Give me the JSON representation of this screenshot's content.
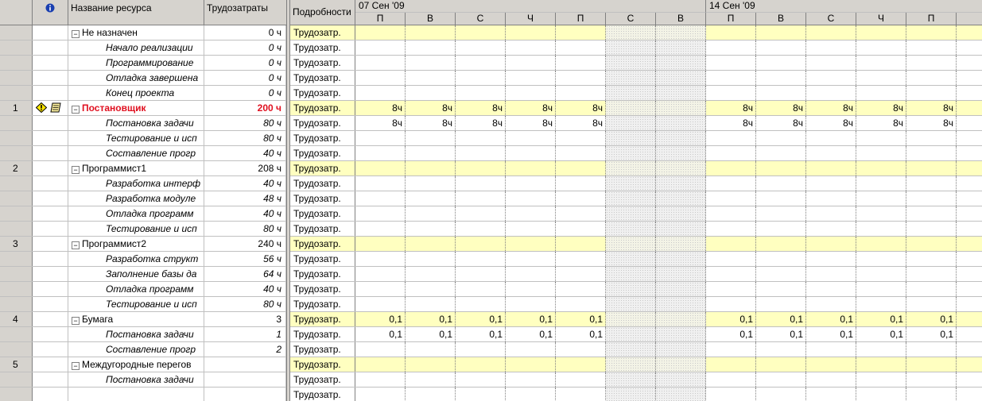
{
  "columns": {
    "indicators_icon": "info-icon",
    "name": "Название ресурса",
    "work": "Трудозатраты",
    "details": "Подробности"
  },
  "timescale": {
    "weeks": [
      "07 Сен '09",
      "14 Сен '09"
    ],
    "days": [
      "П",
      "В",
      "С",
      "Ч",
      "П",
      "С",
      "В",
      "П",
      "В",
      "С",
      "Ч",
      "П"
    ]
  },
  "detail_label": "Трудозатр.",
  "rows": [
    {
      "id": "",
      "name": "Не назначен",
      "work": "0 ч",
      "level": 0,
      "expanded": true,
      "overalloc": false,
      "cells": [
        "",
        "",
        "",
        "",
        "",
        "",
        "",
        "",
        "",
        "",
        "",
        ""
      ]
    },
    {
      "id": "",
      "name": "Начало реализации",
      "work": "0 ч",
      "level": 1,
      "cells": [
        "",
        "",
        "",
        "",
        "",
        "",
        "",
        "",
        "",
        "",
        "",
        ""
      ]
    },
    {
      "id": "",
      "name": "Программирование",
      "work": "0 ч",
      "level": 1,
      "cells": [
        "",
        "",
        "",
        "",
        "",
        "",
        "",
        "",
        "",
        "",
        "",
        ""
      ]
    },
    {
      "id": "",
      "name": "Отладка завершена",
      "work": "0 ч",
      "level": 1,
      "cells": [
        "",
        "",
        "",
        "",
        "",
        "",
        "",
        "",
        "",
        "",
        "",
        ""
      ]
    },
    {
      "id": "",
      "name": "Конец проекта",
      "work": "0 ч",
      "level": 1,
      "cells": [
        "",
        "",
        "",
        "",
        "",
        "",
        "",
        "",
        "",
        "",
        "",
        ""
      ]
    },
    {
      "id": "1",
      "name": "Постановщик",
      "work": "200 ч",
      "level": 0,
      "expanded": true,
      "overalloc": true,
      "icons": [
        "warning-icon",
        "note-icon"
      ],
      "cells": [
        "8ч",
        "8ч",
        "8ч",
        "8ч",
        "8ч",
        "",
        "",
        "8ч",
        "8ч",
        "8ч",
        "8ч",
        "8ч"
      ]
    },
    {
      "id": "",
      "name": "Постановка задачи",
      "work": "80 ч",
      "level": 1,
      "cells": [
        "8ч",
        "8ч",
        "8ч",
        "8ч",
        "8ч",
        "",
        "",
        "8ч",
        "8ч",
        "8ч",
        "8ч",
        "8ч"
      ]
    },
    {
      "id": "",
      "name": "Тестирование и исп",
      "work": "80 ч",
      "level": 1,
      "cells": [
        "",
        "",
        "",
        "",
        "",
        "",
        "",
        "",
        "",
        "",
        "",
        ""
      ]
    },
    {
      "id": "",
      "name": "Составление прогр",
      "work": "40 ч",
      "level": 1,
      "cells": [
        "",
        "",
        "",
        "",
        "",
        "",
        "",
        "",
        "",
        "",
        "",
        ""
      ]
    },
    {
      "id": "2",
      "name": "Программист1",
      "work": "208 ч",
      "level": 0,
      "expanded": true,
      "overalloc": false,
      "cells": [
        "",
        "",
        "",
        "",
        "",
        "",
        "",
        "",
        "",
        "",
        "",
        ""
      ]
    },
    {
      "id": "",
      "name": "Разработка интерф",
      "work": "40 ч",
      "level": 1,
      "cells": [
        "",
        "",
        "",
        "",
        "",
        "",
        "",
        "",
        "",
        "",
        "",
        ""
      ]
    },
    {
      "id": "",
      "name": "Разработка модуле",
      "work": "48 ч",
      "level": 1,
      "cells": [
        "",
        "",
        "",
        "",
        "",
        "",
        "",
        "",
        "",
        "",
        "",
        ""
      ]
    },
    {
      "id": "",
      "name": "Отладка программ",
      "work": "40 ч",
      "level": 1,
      "cells": [
        "",
        "",
        "",
        "",
        "",
        "",
        "",
        "",
        "",
        "",
        "",
        ""
      ]
    },
    {
      "id": "",
      "name": "Тестирование и исп",
      "work": "80 ч",
      "level": 1,
      "cells": [
        "",
        "",
        "",
        "",
        "",
        "",
        "",
        "",
        "",
        "",
        "",
        ""
      ]
    },
    {
      "id": "3",
      "name": "Программист2",
      "work": "240 ч",
      "level": 0,
      "expanded": true,
      "overalloc": false,
      "cells": [
        "",
        "",
        "",
        "",
        "",
        "",
        "",
        "",
        "",
        "",
        "",
        ""
      ]
    },
    {
      "id": "",
      "name": "Разработка структ",
      "work": "56 ч",
      "level": 1,
      "cells": [
        "",
        "",
        "",
        "",
        "",
        "",
        "",
        "",
        "",
        "",
        "",
        ""
      ]
    },
    {
      "id": "",
      "name": "Заполнение базы да",
      "work": "64 ч",
      "level": 1,
      "cells": [
        "",
        "",
        "",
        "",
        "",
        "",
        "",
        "",
        "",
        "",
        "",
        ""
      ]
    },
    {
      "id": "",
      "name": "Отладка программ",
      "work": "40 ч",
      "level": 1,
      "cells": [
        "",
        "",
        "",
        "",
        "",
        "",
        "",
        "",
        "",
        "",
        "",
        ""
      ]
    },
    {
      "id": "",
      "name": "Тестирование и исп",
      "work": "80 ч",
      "level": 1,
      "cells": [
        "",
        "",
        "",
        "",
        "",
        "",
        "",
        "",
        "",
        "",
        "",
        ""
      ]
    },
    {
      "id": "4",
      "name": "Бумага",
      "work": "3",
      "level": 0,
      "expanded": true,
      "overalloc": false,
      "cells": [
        "0,1",
        "0,1",
        "0,1",
        "0,1",
        "0,1",
        "",
        "",
        "0,1",
        "0,1",
        "0,1",
        "0,1",
        "0,1"
      ]
    },
    {
      "id": "",
      "name": "Постановка задачи",
      "work": "1",
      "level": 1,
      "cells": [
        "0,1",
        "0,1",
        "0,1",
        "0,1",
        "0,1",
        "",
        "",
        "0,1",
        "0,1",
        "0,1",
        "0,1",
        "0,1"
      ]
    },
    {
      "id": "",
      "name": "Составление прогр",
      "work": "2",
      "level": 1,
      "cells": [
        "",
        "",
        "",
        "",
        "",
        "",
        "",
        "",
        "",
        "",
        "",
        ""
      ]
    },
    {
      "id": "5",
      "name": "Междугородные перегов",
      "work": "",
      "level": 0,
      "expanded": true,
      "overalloc": false,
      "cells": [
        "",
        "",
        "",
        "",
        "",
        "",
        "",
        "",
        "",
        "",
        "",
        ""
      ]
    },
    {
      "id": "",
      "name": "Постановка задачи",
      "work": "",
      "level": 1,
      "cells": [
        "",
        "",
        "",
        "",
        "",
        "",
        "",
        "",
        "",
        "",
        "",
        ""
      ]
    },
    {
      "id": "",
      "name": "",
      "work": "",
      "level": 1,
      "cells": [
        "",
        "",
        "",
        "",
        "",
        "",
        "",
        "",
        "",
        "",
        "",
        ""
      ]
    }
  ],
  "colors": {
    "highlight": "#ffffc0",
    "overallocated": "#e01020",
    "header": "#d6d3ce"
  }
}
